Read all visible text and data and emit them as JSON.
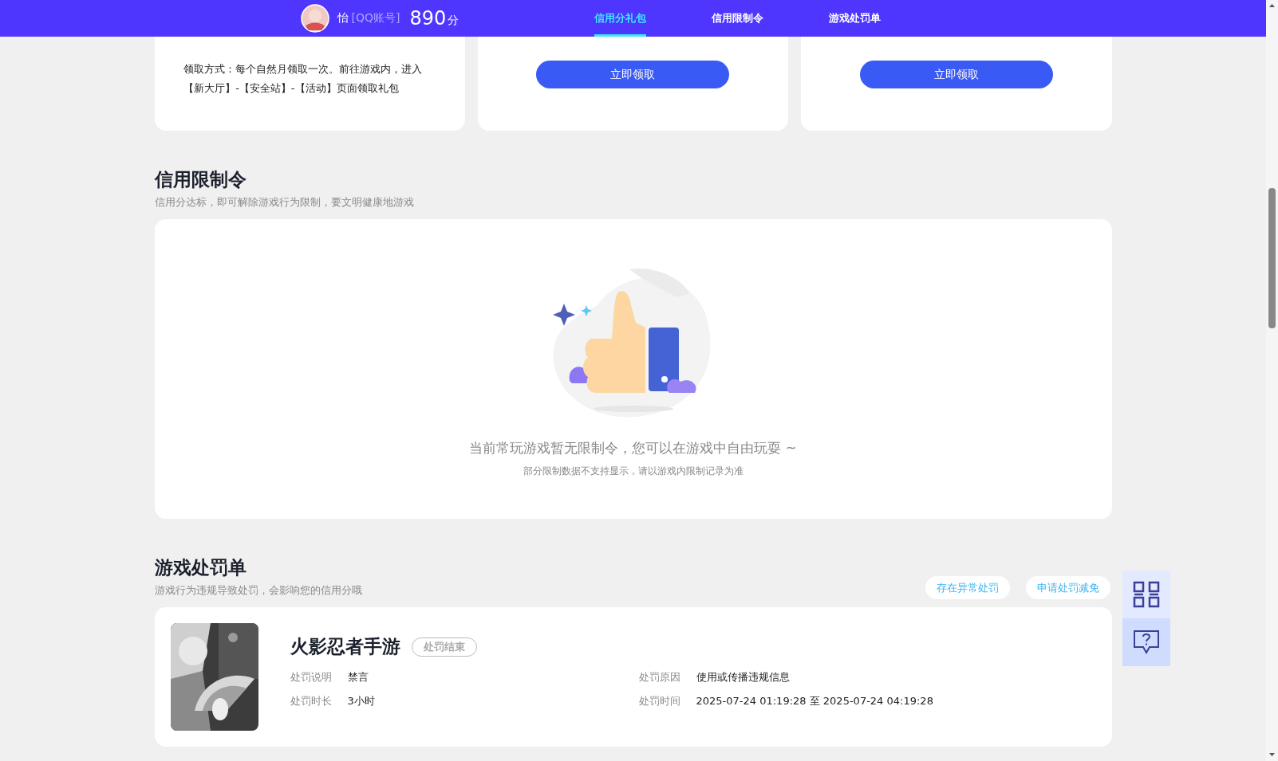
{
  "header": {
    "user_name": "怡",
    "account_label": "[QQ账号]",
    "score": "890",
    "score_unit": "分",
    "tabs": [
      {
        "label": "信用分礼包",
        "selected": true
      },
      {
        "label": "信用限制令",
        "selected": false
      },
      {
        "label": "游戏处罚单",
        "selected": false
      }
    ]
  },
  "gift_cards": [
    {
      "kind": "text",
      "text": "领取方式：每个自然月领取一次。前往游戏内，进入【新大厅】-【安全站】-【活动】页面领取礼包"
    },
    {
      "kind": "button",
      "button": "立即领取"
    },
    {
      "kind": "button",
      "button": "立即领取"
    }
  ],
  "restriction_section": {
    "title": "信用限制令",
    "subtitle": "信用分达标，即可解除游戏行为限制，要文明健康地游戏",
    "empty_state": {
      "message": "当前常玩游戏暂无限制令，您可以在游戏中自由玩耍 ~",
      "note": "部分限制数据不支持显示，请以游戏内限制记录为准"
    }
  },
  "penalty_section": {
    "title": "游戏处罚单",
    "subtitle": "游戏行为违规导致处罚，会影响您的信用分哦",
    "actions": [
      "存在异常处罚",
      "申请处罚减免"
    ],
    "records": [
      {
        "game": "火影忍者手游",
        "status": "处罚结束",
        "fields": [
          {
            "label": "处罚说明",
            "value": "禁言"
          },
          {
            "label": "处罚原因",
            "value": "使用或传播违规信息"
          },
          {
            "label": "处罚时长",
            "value": "3小时"
          },
          {
            "label": "处罚时间",
            "value": "2025-07-24 01:19:28 至 2025-07-24 04:19:28"
          }
        ]
      }
    ]
  }
}
